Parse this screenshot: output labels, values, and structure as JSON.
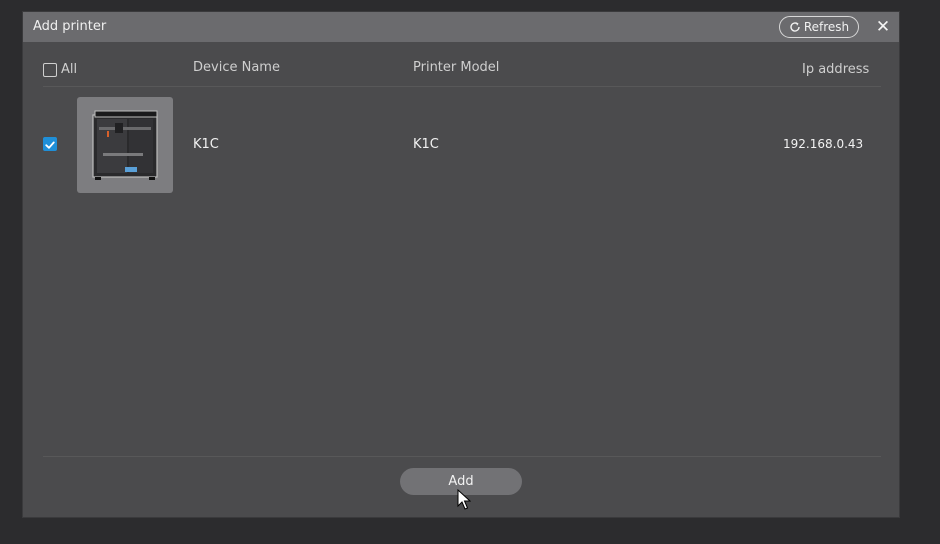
{
  "dialog": {
    "title": "Add printer",
    "refresh_label": "Refresh",
    "refresh_icon": "refresh-icon",
    "close_icon": "close-icon",
    "close_glyph": "✕"
  },
  "table": {
    "select_all_label": "All",
    "select_all_checked": false,
    "headers": {
      "device_name": "Device Name",
      "printer_model": "Printer Model",
      "ip_address": "Ip address"
    },
    "rows": [
      {
        "checked": true,
        "image_icon": "printer-image",
        "device_name": "K1C",
        "printer_model": "K1C",
        "ip_address": "192.168.0.43"
      }
    ]
  },
  "footer": {
    "add_label": "Add"
  },
  "colors": {
    "accent": "#1f8fd8",
    "dialog_bg": "#4b4b4d",
    "titlebar_bg": "#6b6b6e",
    "button_bg": "#727275"
  }
}
